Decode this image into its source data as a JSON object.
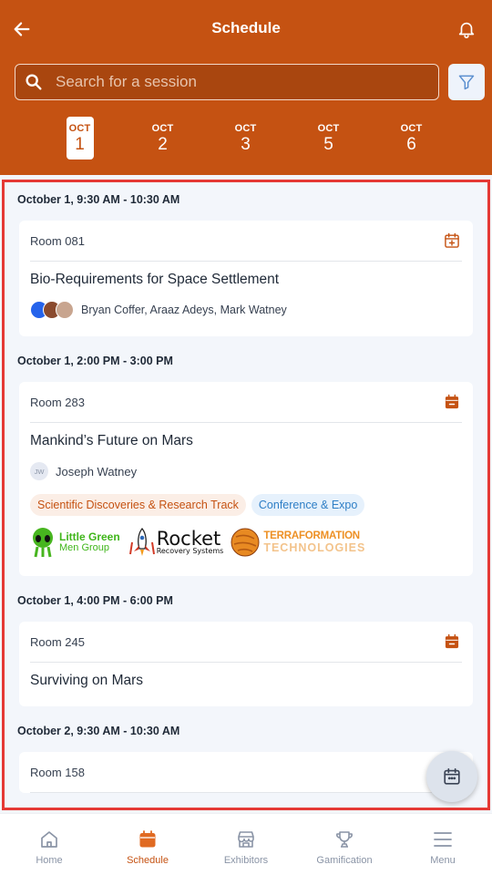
{
  "app": {
    "title": "Schedule",
    "accent_color": "#c55212"
  },
  "search": {
    "placeholder": "Search for a session"
  },
  "dates": [
    {
      "month": "OCT",
      "day": "1",
      "active": true
    },
    {
      "month": "OCT",
      "day": "2",
      "active": false
    },
    {
      "month": "OCT",
      "day": "3",
      "active": false
    },
    {
      "month": "OCT",
      "day": "5",
      "active": false
    },
    {
      "month": "OCT",
      "day": "6",
      "active": false
    }
  ],
  "slots": [
    {
      "time": "October 1, 9:30 AM - 10:30 AM",
      "room": "Room 081",
      "title": "Bio-Requirements for Space Settlement",
      "speakers": "Bryan Coffer, Araaz Adeys, Mark Watney",
      "calendar_icon": "calendar-add-icon"
    },
    {
      "time": "October 1, 2:00 PM - 3:00 PM",
      "room": "Room 283",
      "title": "Mankind’s Future on Mars",
      "speaker_initials": "JW",
      "speakers": "Joseph Watney",
      "calendar_icon": "calendar-remove-icon",
      "tags": [
        "Scientific Discoveries & Research Track",
        "Conference & Expo"
      ],
      "sponsors": {
        "little_green_line1": "Little Green",
        "little_green_line2": "Men Group",
        "rocket_line1": "Rocket",
        "rocket_line2": "Recovery Systems",
        "terra_line1": "TERRAFORMATION",
        "terra_line2": "TECHNOLOGIES"
      }
    },
    {
      "time": "October 1, 4:00 PM - 6:00 PM",
      "room": "Room 245",
      "title": "Surviving on Mars",
      "calendar_icon": "calendar-remove-icon"
    },
    {
      "time": "October 2, 9:30 AM - 10:30 AM",
      "room": "Room 158"
    }
  ],
  "nav": [
    {
      "label": "Home",
      "icon": "home-icon",
      "active": false
    },
    {
      "label": "Schedule",
      "icon": "calendar-icon",
      "active": true
    },
    {
      "label": "Exhibitors",
      "icon": "store-icon",
      "active": false
    },
    {
      "label": "Gamification",
      "icon": "trophy-icon",
      "active": false
    },
    {
      "label": "Menu",
      "icon": "menu-icon",
      "active": false
    }
  ]
}
